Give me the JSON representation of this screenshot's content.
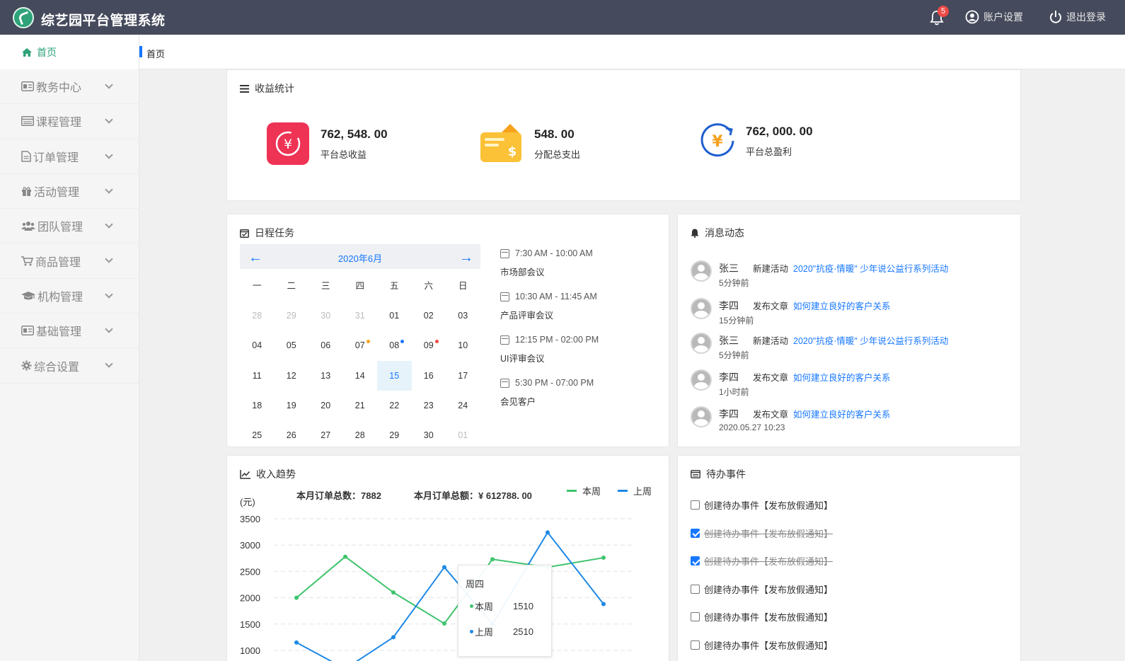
{
  "header": {
    "title": "综艺园平台管理系统",
    "notification_count": "5",
    "account_label": "账户设置",
    "logout_label": "退出登录"
  },
  "sidebar": {
    "home_label": "首页",
    "items": [
      {
        "label": "教务中心",
        "icon": "id-card-icon"
      },
      {
        "label": "课程管理",
        "icon": "list-icon"
      },
      {
        "label": "订单管理",
        "icon": "file-icon"
      },
      {
        "label": "活动管理",
        "icon": "gift-icon"
      },
      {
        "label": "团队管理",
        "icon": "users-icon"
      },
      {
        "label": "商品管理",
        "icon": "cart-icon"
      },
      {
        "label": "机构管理",
        "icon": "graduation-cap-icon"
      },
      {
        "label": "基础管理",
        "icon": "id-card-icon"
      },
      {
        "label": "综合设置",
        "icon": "gear-icon"
      }
    ]
  },
  "breadcrumb": {
    "current": "首页"
  },
  "income": {
    "title": "收益统计",
    "stats": [
      {
        "value": "762, 548. 00",
        "label": "平台总收益"
      },
      {
        "value": "548. 00",
        "label": "分配总支出"
      },
      {
        "value": "762, 000. 00",
        "label": "平台总盈利"
      }
    ]
  },
  "schedule": {
    "title": "日程任务",
    "month": "2020年6月",
    "weekdays": [
      "一",
      "二",
      "三",
      "四",
      "五",
      "六",
      "日"
    ],
    "weeks": [
      [
        "28",
        "29",
        "30",
        "31",
        "01",
        "02",
        "03"
      ],
      [
        "04",
        "05",
        "06",
        "07",
        "08",
        "09",
        "10"
      ],
      [
        "11",
        "12",
        "13",
        "14",
        "15",
        "16",
        "17"
      ],
      [
        "18",
        "19",
        "20",
        "21",
        "22",
        "23",
        "24"
      ],
      [
        "25",
        "26",
        "27",
        "28",
        "29",
        "30",
        "01"
      ]
    ],
    "events": [
      {
        "time": "7:30 AM - 10:00 AM",
        "name": "市场部会议"
      },
      {
        "time": "10:30 AM - 11:45 AM",
        "name": "产品评审会议"
      },
      {
        "time": "12:15 PM - 02:00 PM",
        "name": "UI评审会议"
      },
      {
        "time": "5:30 PM - 07:00 PM",
        "name": "会见客户"
      }
    ]
  },
  "messages": {
    "title": "消息动态",
    "items": [
      {
        "user": "张三",
        "action": "新建活动",
        "link": "2020\"抗疫·情暖\" 少年说公益行系列活动",
        "time": "5分钟前"
      },
      {
        "user": "李四",
        "action": "发布文章",
        "link": "如何建立良好的客户关系",
        "time": "15分钟前"
      },
      {
        "user": "张三",
        "action": "新建活动",
        "link": "2020\"抗疫·情暖\" 少年说公益行系列活动",
        "time": "5分钟前"
      },
      {
        "user": "李四",
        "action": "发布文章",
        "link": "如何建立良好的客户关系",
        "time": "1小时前"
      },
      {
        "user": "李四",
        "action": "发布文章",
        "link": "如何建立良好的客户关系",
        "time": "2020.05.27 10:23"
      }
    ]
  },
  "trend": {
    "title": "收入趋势",
    "orders_label": "本月订单总数：7882",
    "amount_label": "本月订单总额：¥ 612788. 00",
    "tooltip": {
      "day": "周四",
      "rows": [
        {
          "name": "本周",
          "value": "1510"
        },
        {
          "name": "上周",
          "value": "2510"
        }
      ]
    }
  },
  "chart_data": {
    "type": "line",
    "ylabel": "(元)",
    "yticks": [
      "3500",
      "3000",
      "2500",
      "2000",
      "1500",
      "1000"
    ],
    "ylim": [
      500,
      3500
    ],
    "x": [
      1,
      2,
      3,
      4,
      5,
      6,
      7
    ],
    "series": [
      {
        "name": "本周",
        "color": "#3ec46d",
        "values": [
          2000,
          2780,
          2100,
          1510,
          2730,
          2580,
          2760
        ]
      },
      {
        "name": "上周",
        "color": "#1e88e5",
        "values": [
          1150,
          650,
          1250,
          2580,
          1500,
          3240,
          1880
        ]
      }
    ],
    "legend": "top-right",
    "grid": true
  },
  "todos": {
    "title": "待办事件",
    "items": [
      {
        "label": "创建待办事件【发布放假通知】",
        "done": false
      },
      {
        "label": "创建待办事件【发布放假通知】",
        "done": true
      },
      {
        "label": "创建待办事件【发布放假通知】",
        "done": true
      },
      {
        "label": "创建待办事件【发布放假通知】",
        "done": false
      },
      {
        "label": "创建待办事件【发布放假通知】",
        "done": false
      },
      {
        "label": "创建待办事件【发布放假通知】",
        "done": false
      }
    ]
  }
}
